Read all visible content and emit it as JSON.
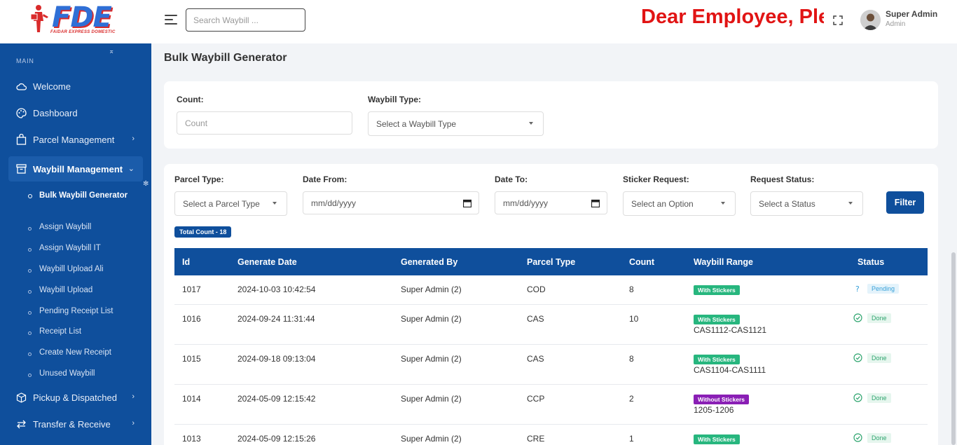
{
  "header": {
    "logo_text": "FDE",
    "logo_sub": "FAIDAR EXPRESS DOMESTIC",
    "search_placeholder": "Search Waybill ...",
    "notice": "Dear Employee, Please",
    "user_name": "Super Admin",
    "user_role": "Admin"
  },
  "sidebar": {
    "section": "MAIN",
    "items": [
      {
        "label": "Welcome",
        "icon": "cloud-icon"
      },
      {
        "label": "Dashboard",
        "icon": "palette-icon"
      },
      {
        "label": "Parcel Management",
        "icon": "bag-icon"
      },
      {
        "label": "Waybill Management",
        "icon": "box-icon"
      },
      {
        "label": "Pickup & Dispatched",
        "icon": "cube-icon"
      },
      {
        "label": "Transfer & Receive",
        "icon": "transfer-icon"
      }
    ],
    "sub_items": [
      "Bulk Waybill Generator",
      "Assign Waybill",
      "Assign Waybill IT",
      "Waybill Upload Ali",
      "Waybill Upload",
      "Pending Receipt List",
      "Receipt List",
      "Create New Receipt",
      "Unused Waybill"
    ]
  },
  "page": {
    "title": "Bulk Waybill Generator"
  },
  "generator": {
    "count_label": "Count:",
    "count_placeholder": "Count",
    "type_label": "Waybill Type:",
    "type_value": "Select a Waybill Type"
  },
  "filters": {
    "parcel_type_label": "Parcel Type:",
    "parcel_type_value": "Select a Parcel Type",
    "date_from_label": "Date From:",
    "date_from_value": "mm/dd/yyyy",
    "date_to_label": "Date To:",
    "date_to_value": "mm/dd/yyyy",
    "sticker_label": "Sticker Request:",
    "sticker_value": "Select an Option",
    "status_label": "Request Status:",
    "status_value": "Select a Status",
    "filter_button": "Filter",
    "total_count": "Total Count - 18"
  },
  "table": {
    "headers": [
      "Id",
      "Generate Date",
      "Generated By",
      "Parcel Type",
      "Count",
      "Waybill Range",
      "Status"
    ],
    "rows": [
      {
        "id": "1017",
        "date": "2024-10-03 10:42:54",
        "by": "Super Admin (2)",
        "type": "COD",
        "count": "8",
        "tag": "With Stickers",
        "tag_kind": "with",
        "range": "",
        "status": "Pending",
        "status_kind": "pending"
      },
      {
        "id": "1016",
        "date": "2024-09-24 11:31:44",
        "by": "Super Admin (2)",
        "type": "CAS",
        "count": "10",
        "tag": "With Stickers",
        "tag_kind": "with",
        "range": "CAS1112-CAS1121",
        "status": "Done",
        "status_kind": "done"
      },
      {
        "id": "1015",
        "date": "2024-09-18 09:13:04",
        "by": "Super Admin (2)",
        "type": "CAS",
        "count": "8",
        "tag": "With Stickers",
        "tag_kind": "with",
        "range": "CAS1104-CAS1111",
        "status": "Done",
        "status_kind": "done"
      },
      {
        "id": "1014",
        "date": "2024-05-09 12:15:42",
        "by": "Super Admin (2)",
        "type": "CCP",
        "count": "2",
        "tag": "Without Stickers",
        "tag_kind": "without",
        "range": "1205-1206",
        "status": "Done",
        "status_kind": "done"
      },
      {
        "id": "1013",
        "date": "2024-05-09 12:15:26",
        "by": "Super Admin (2)",
        "type": "CRE",
        "count": "1",
        "tag": "With Stickers",
        "tag_kind": "with",
        "range": "",
        "status": "Done",
        "status_kind": "done"
      }
    ]
  },
  "colors": {
    "primary": "#0f4f9c",
    "notice": "#e11414",
    "tag_with": "#27b67e",
    "tag_without": "#8a1fb5"
  }
}
